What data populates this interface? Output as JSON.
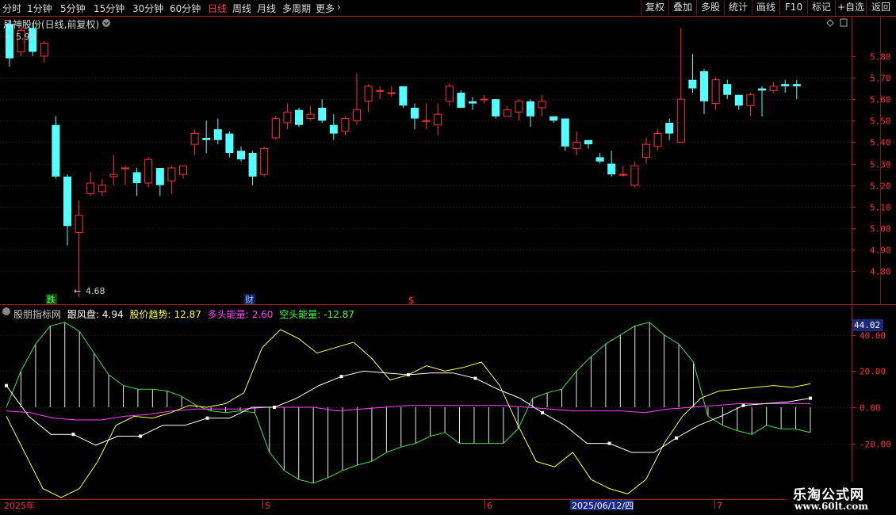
{
  "toolbar": {
    "periods": [
      "分时",
      "1分钟",
      "5分钟",
      "15分钟",
      "30分钟",
      "60分钟",
      "日线",
      "周线",
      "月线",
      "多周期",
      "更多"
    ],
    "active_period": "日线",
    "buttons": [
      "复权",
      "叠加",
      "多股",
      "统计",
      "画线",
      "F10",
      "+自选",
      "返回"
    ],
    "extra_right": "标记"
  },
  "main_header": {
    "title": "风神股份(日线,前复权)"
  },
  "price_labels": {
    "high": "5.95",
    "low": "4.68"
  },
  "markers": {
    "die": "跌",
    "cai": "财",
    "s": "$"
  },
  "indicator_header": {
    "name": "股朋指标网",
    "items": [
      {
        "label": "跟风盘:",
        "value": "4.94",
        "color": "#ffffff"
      },
      {
        "label": "股价趋势:",
        "value": "12.87",
        "color": "#ffff40"
      },
      {
        "label": "多头能量:",
        "value": "2.60",
        "color": "#ff40ff"
      },
      {
        "label": "空头能量:",
        "value": "-12.87",
        "color": "#40ff40"
      }
    ]
  },
  "price_axis": [
    "5.80",
    "5.70",
    "5.60",
    "5.50",
    "5.40",
    "5.30",
    "5.20",
    "5.10",
    "5.00",
    "4.90",
    "4.80"
  ],
  "indicator_axis": [
    "40.00",
    "20.00",
    "0.00",
    "-20.00"
  ],
  "indicator_current": "44.02",
  "dates": {
    "year": "2025年",
    "m5": "5",
    "m6": "6",
    "cursor": "2025/06/12/四",
    "m7": "7"
  },
  "watermark": {
    "line1": "乐淘公式网",
    "line2": "www.60lt.com"
  },
  "colors": {
    "up": "#ff3232",
    "down": "#54ffff",
    "axis": "#b01e1e",
    "grid": "#501414"
  },
  "chart_data": {
    "type": "candlestick",
    "price_range": [
      4.65,
      5.98
    ],
    "candles": [
      [
        5.95,
        5.79,
        5.97,
        5.75
      ],
      [
        5.82,
        5.92,
        5.94,
        5.8
      ],
      [
        5.93,
        5.82,
        5.95,
        5.8
      ],
      [
        5.8,
        5.86,
        5.87,
        5.77
      ],
      [
        5.48,
        5.24,
        5.52,
        5.23
      ],
      [
        5.24,
        5.01,
        5.25,
        4.92
      ],
      [
        4.98,
        5.06,
        5.13,
        4.68
      ],
      [
        5.16,
        5.21,
        5.26,
        5.15
      ],
      [
        5.17,
        5.2,
        5.23,
        5.15
      ],
      [
        5.24,
        5.25,
        5.34,
        5.2
      ],
      [
        5.28,
        5.28,
        5.29,
        5.2
      ],
      [
        5.26,
        5.21,
        5.28,
        5.15
      ],
      [
        5.21,
        5.32,
        5.33,
        5.19
      ],
      [
        5.28,
        5.2,
        5.28,
        5.15
      ],
      [
        5.22,
        5.28,
        5.29,
        5.16
      ],
      [
        5.25,
        5.29,
        5.29,
        5.23
      ],
      [
        5.39,
        5.44,
        5.46,
        5.34
      ],
      [
        5.42,
        5.41,
        5.5,
        5.35
      ],
      [
        5.46,
        5.41,
        5.51,
        5.39
      ],
      [
        5.44,
        5.35,
        5.45,
        5.33
      ],
      [
        5.36,
        5.32,
        5.38,
        5.31
      ],
      [
        5.35,
        5.24,
        5.36,
        5.2
      ],
      [
        5.25,
        5.37,
        5.38,
        5.24
      ],
      [
        5.42,
        5.51,
        5.52,
        5.41
      ],
      [
        5.49,
        5.54,
        5.58,
        5.46
      ],
      [
        5.55,
        5.48,
        5.56,
        5.47
      ],
      [
        5.51,
        5.53,
        5.57,
        5.5
      ],
      [
        5.56,
        5.5,
        5.6,
        5.49
      ],
      [
        5.48,
        5.44,
        5.53,
        5.41
      ],
      [
        5.45,
        5.51,
        5.52,
        5.43
      ],
      [
        5.5,
        5.55,
        5.72,
        5.48
      ],
      [
        5.59,
        5.66,
        5.67,
        5.54
      ],
      [
        5.64,
        5.64,
        5.66,
        5.6
      ],
      [
        5.63,
        5.63,
        5.66,
        5.61
      ],
      [
        5.66,
        5.57,
        5.66,
        5.56
      ],
      [
        5.56,
        5.51,
        5.58,
        5.46
      ],
      [
        5.5,
        5.5,
        5.58,
        5.46
      ],
      [
        5.48,
        5.53,
        5.58,
        5.43
      ],
      [
        5.59,
        5.66,
        5.67,
        5.57
      ],
      [
        5.63,
        5.56,
        5.64,
        5.56
      ],
      [
        5.59,
        5.58,
        5.61,
        5.55
      ],
      [
        5.6,
        5.6,
        5.62,
        5.58
      ],
      [
        5.6,
        5.52,
        5.6,
        5.51
      ],
      [
        5.52,
        5.55,
        5.57,
        5.52
      ],
      [
        5.54,
        5.59,
        5.6,
        5.5
      ],
      [
        5.59,
        5.52,
        5.6,
        5.47
      ],
      [
        5.56,
        5.59,
        5.62,
        5.52
      ],
      [
        5.52,
        5.5,
        5.52,
        5.49
      ],
      [
        5.51,
        5.38,
        5.51,
        5.36
      ],
      [
        5.37,
        5.4,
        5.45,
        5.34
      ],
      [
        5.41,
        5.39,
        5.41,
        5.37
      ],
      [
        5.33,
        5.31,
        5.35,
        5.3
      ],
      [
        5.3,
        5.25,
        5.36,
        5.24
      ],
      [
        5.25,
        5.25,
        5.29,
        5.24
      ],
      [
        5.2,
        5.29,
        5.31,
        5.19
      ],
      [
        5.33,
        5.39,
        5.42,
        5.3
      ],
      [
        5.38,
        5.44,
        5.46,
        5.36
      ],
      [
        5.49,
        5.44,
        5.51,
        5.41
      ],
      [
        5.4,
        5.6,
        5.93,
        5.4
      ],
      [
        5.69,
        5.65,
        5.81,
        5.63
      ],
      [
        5.73,
        5.59,
        5.74,
        5.53
      ],
      [
        5.58,
        5.69,
        5.7,
        5.55
      ],
      [
        5.67,
        5.62,
        5.69,
        5.6
      ],
      [
        5.62,
        5.57,
        5.62,
        5.55
      ],
      [
        5.57,
        5.62,
        5.63,
        5.52
      ],
      [
        5.65,
        5.64,
        5.66,
        5.52
      ],
      [
        5.64,
        5.66,
        5.68,
        5.63
      ],
      [
        5.67,
        5.66,
        5.69,
        5.63
      ],
      [
        5.67,
        5.66,
        5.69,
        5.6
      ]
    ],
    "indicator_range": [
      -50,
      50
    ],
    "indicator_series": {
      "bars": [
        0,
        20,
        35,
        45,
        47,
        42,
        30,
        18,
        12,
        10,
        10,
        9,
        6,
        1,
        -2,
        -3,
        -2,
        -3,
        -25,
        -35,
        -40,
        -42,
        -39,
        -35,
        -32,
        -30,
        -25,
        -22,
        -20,
        -16,
        -14,
        -20,
        -20,
        -20,
        -20,
        -12,
        5,
        8,
        10,
        20,
        28,
        35,
        40,
        45,
        47,
        40,
        35,
        25,
        -5,
        -10,
        -13,
        -15,
        -10,
        -12,
        -12,
        -14
      ],
      "yellow": [
        -5,
        -25,
        -45,
        -50,
        -45,
        -30,
        -10,
        -5,
        -6,
        -3,
        1,
        0,
        2,
        8,
        33,
        43,
        38,
        30,
        33,
        36,
        27,
        15,
        18,
        23,
        20,
        22,
        25,
        12,
        -10,
        -30,
        -33,
        -25,
        -40,
        -45,
        -48,
        -40,
        -20,
        -5,
        5,
        9,
        10,
        11,
        12,
        11,
        13
      ],
      "white": [
        12,
        -5,
        -15,
        -15,
        -21,
        -16,
        -16,
        -10,
        -10,
        -6,
        -6,
        0,
        0,
        5,
        12,
        17,
        20,
        19,
        18,
        19,
        19,
        16,
        10,
        5,
        -3,
        -10,
        -20,
        -20,
        -25,
        -25,
        -17,
        -10,
        -5,
        1,
        2,
        3,
        5
      ],
      "magenta": [
        -2,
        -3,
        -6,
        -7,
        -7,
        -5,
        -4,
        -2,
        -1,
        -1,
        -1,
        0,
        0,
        0,
        -2,
        -1,
        0,
        1,
        1,
        1,
        1,
        1,
        0,
        -1,
        -2,
        -2,
        -2,
        -3,
        -1,
        0,
        1,
        2,
        2,
        2,
        2
      ]
    }
  }
}
